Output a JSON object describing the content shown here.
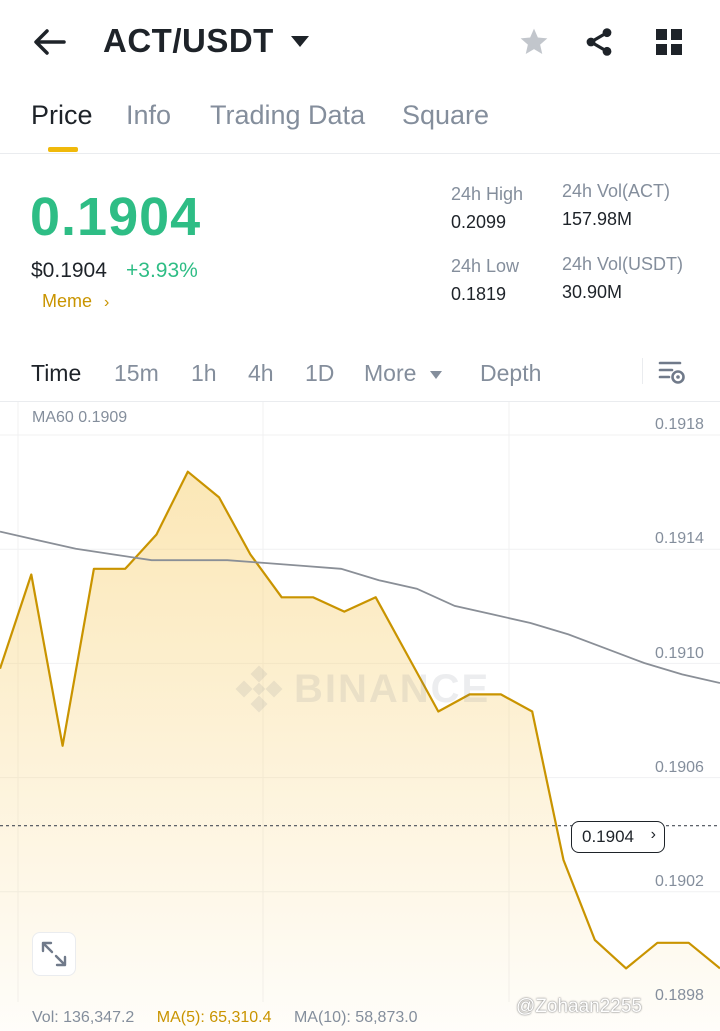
{
  "header": {
    "pair": "ACT/USDT"
  },
  "tabs": [
    {
      "label": "Price"
    },
    {
      "label": "Info"
    },
    {
      "label": "Trading Data"
    },
    {
      "label": "Square"
    }
  ],
  "price": {
    "last": "0.1904",
    "usd": "$0.1904",
    "change_pct": "+3.93%",
    "tag": "Meme",
    "color_up": "#2ebd85"
  },
  "stats": {
    "high_label": "24h High",
    "high_value": "0.2099",
    "low_label": "24h Low",
    "low_value": "0.1819",
    "vol_base_label": "24h Vol(ACT)",
    "vol_base_value": "157.98M",
    "vol_quote_label": "24h Vol(USDT)",
    "vol_quote_value": "30.90M"
  },
  "intervals": {
    "time": "Time",
    "m15": "15m",
    "h1": "1h",
    "h4": "4h",
    "d1": "1D",
    "more": "More",
    "depth": "Depth"
  },
  "chart_data": {
    "type": "area",
    "ma_label": "MA60 0.1909",
    "y_ticks": [
      "0.1918",
      "0.1914",
      "0.1910",
      "0.1906",
      "0.1902",
      "0.1898"
    ],
    "ylim": [
      0.1897,
      0.1919
    ],
    "current_price": "0.1904",
    "series": [
      {
        "values": [
          0.19095,
          0.19128,
          0.19068,
          0.1913,
          0.1913,
          0.19142,
          0.19164,
          0.19155,
          0.19135,
          0.1912,
          0.1912,
          0.19115,
          0.1912,
          0.191,
          0.1908,
          0.19086,
          0.19086,
          0.1908,
          0.19028,
          0.19,
          0.1899,
          0.18999,
          0.18999,
          0.1899
        ]
      },
      {
        "name": "MA60",
        "values": [
          0.19143,
          0.1914,
          0.19137,
          0.19135,
          0.19133,
          0.19133,
          0.19133,
          0.19132,
          0.19131,
          0.1913,
          0.19126,
          0.19123,
          0.19117,
          0.19114,
          0.19111,
          0.19107,
          0.19102,
          0.19097,
          0.19093,
          0.1909
        ]
      }
    ],
    "colors": {
      "price": "#c99400",
      "fill": "#f8d37a",
      "ma60": "#8a8f97"
    }
  },
  "volume": {
    "vol": "Vol: 136,347.2",
    "ma5": "MA(5): 65,310.4",
    "ma10": "MA(10): 58,873.0"
  },
  "watermark": "BINANCE",
  "user_tag": "@Zohaan2255"
}
